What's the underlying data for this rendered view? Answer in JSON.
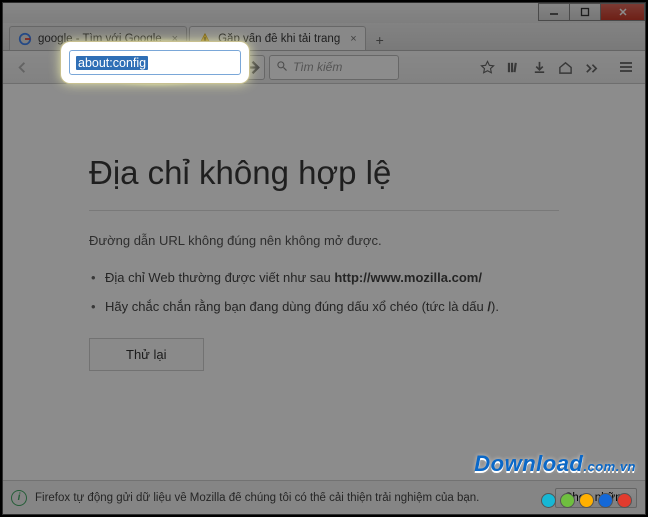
{
  "tabs": [
    {
      "label": "google - Tìm với Google",
      "icon": "google"
    },
    {
      "label": "Gặp vấn đề khi tải trang",
      "icon": "warning"
    }
  ],
  "urlbar": {
    "text": "about:config"
  },
  "go": {
    "title": "Go"
  },
  "searchbox": {
    "placeholder": "Tìm kiếm"
  },
  "toolbar": {
    "star": "bookmark-icon",
    "library": "library-icon",
    "download": "download-icon",
    "home": "home-icon",
    "more": "more-icon",
    "menu": "menu-icon"
  },
  "page": {
    "title": "Địa chỉ không hợp lệ",
    "lead": "Đường dẫn URL không đúng nên không mở được.",
    "bullet1_a": "Địa chỉ Web thường được viết như sau ",
    "bullet1_b": "http://www.mozilla.com/",
    "bullet2_a": "Hãy chắc chắn rằng bạn đang dùng đúng dấu xổ chéo (tức là dấu ",
    "bullet2_b": "/",
    "bullet2_c": ").",
    "retry": "Thử lại"
  },
  "infobar": {
    "message": "Firefox tự động gửi dữ liệu về Mozilla để chúng tôi có thể cải thiện trải nghiệm của bạn.",
    "button": "Chọn những"
  },
  "watermark": {
    "brand": "Download",
    "domain": ".com.vn"
  },
  "dots": [
    "#17b7d4",
    "#6fbf3f",
    "#ffb000",
    "#1368d8",
    "#e23b2e"
  ]
}
